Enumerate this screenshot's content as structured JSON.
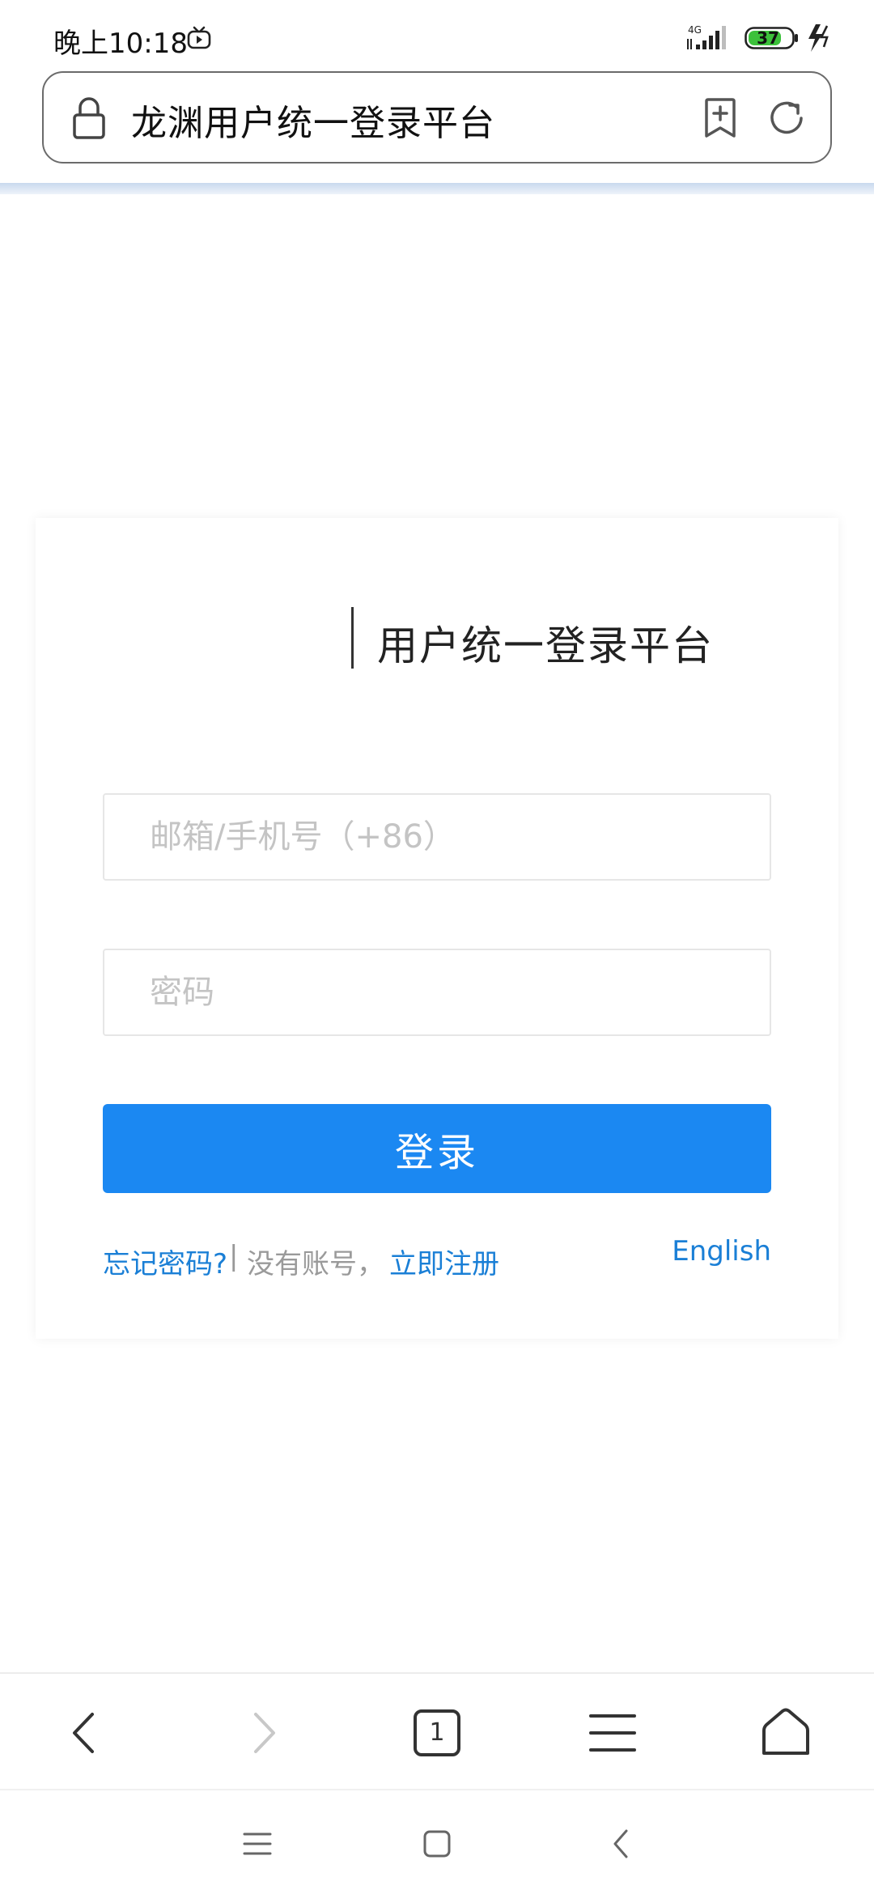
{
  "status_bar": {
    "time": "晚上10:18",
    "network": "4G",
    "battery": "37"
  },
  "address_bar": {
    "title": "龙渊用户统一登录平台",
    "icons": [
      "lock-icon",
      "bookmark-add-icon",
      "refresh-icon"
    ]
  },
  "login": {
    "card_title": "用户统一登录平台",
    "account_placeholder": "邮箱/手机号（+86）",
    "password_placeholder": "密码",
    "submit_label": "登录",
    "forgot_password": "忘记密码?",
    "separator": "|",
    "no_account": "没有账号，",
    "register": "立即注册",
    "language_switch": "English"
  },
  "browser_toolbar": {
    "tabs_count": "1",
    "icons": [
      "back-icon",
      "forward-icon",
      "tabs-icon",
      "menu-icon",
      "home-icon"
    ]
  },
  "system_nav": {
    "icons": [
      "recent-apps-icon",
      "home-square-icon",
      "back-arrow-icon"
    ]
  },
  "colors": {
    "primary": "#1b88f2",
    "link": "#1a7fd6",
    "placeholder": "#c4c4c4",
    "battery_fill": "#3cc13b"
  }
}
